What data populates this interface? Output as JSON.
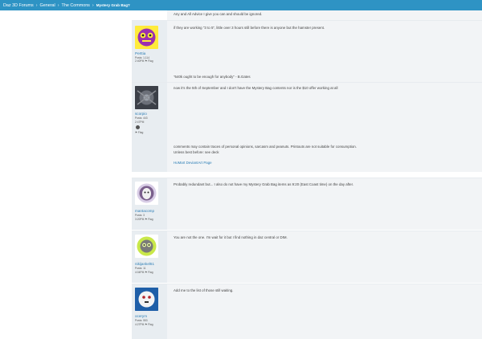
{
  "breadcrumb": {
    "items": [
      "Daz 3D Forums",
      "General",
      "The Commons"
    ],
    "separator": "›",
    "current": "Mystery Grab Bag?"
  },
  "colors": {
    "accent": "#2e93c4",
    "link": "#2b7db5",
    "sidebar": "#e8edf1",
    "post_bg": "#f2f4f6"
  },
  "posts": [
    {
      "lines": [
        "Any and All Advice I give you can and should be ignored."
      ]
    },
    {
      "user": "Perttia",
      "stats": [
        "Posts: 1,114",
        "2:40PM  ⚑ Flag"
      ],
      "lines": [
        "if they are working \"3 to 5\", little over 3 hours still before there is anyone but the hamster present.",
        "\"640k ought to be enough for anybody\" - B.Gates"
      ]
    },
    {
      "user": "scorpio",
      "stats": [
        "Posts: 443",
        "2:47PM",
        "⚑ Flag"
      ],
      "lines": [
        "now it's the 5th of September and I don't have the Mystery Bag contents nor is the $10 offer working at all",
        "comments may contain traces of personal opinions, sarcasm and peanuts. Printouts are not suitable for consumption.",
        "Unless best before: see deck"
      ],
      "link": "HoMart DeviantArt Page"
    },
    {
      "user": "mantacomp",
      "stats": [
        "Posts: 3",
        "3:20PM  ⚑ Flag"
      ],
      "lines": [
        "Probably redundant but... I also do not have my Mystery Grab Bag items as 9:20 (East Coast time) on the day after."
      ]
    },
    {
      "user": "nikijankel61",
      "stats": [
        "Posts: 11",
        "4:04PM  ⚑ Flag"
      ],
      "lines": [
        "You are not the one. I'm wait for it but I find nothing in daz central or DIM."
      ]
    },
    {
      "user": "ocerym",
      "stats": [
        "Posts: 553",
        "4:27PM  ⚑ Flag"
      ],
      "lines": [
        "Add me to the list of those still waiting."
      ]
    }
  ]
}
